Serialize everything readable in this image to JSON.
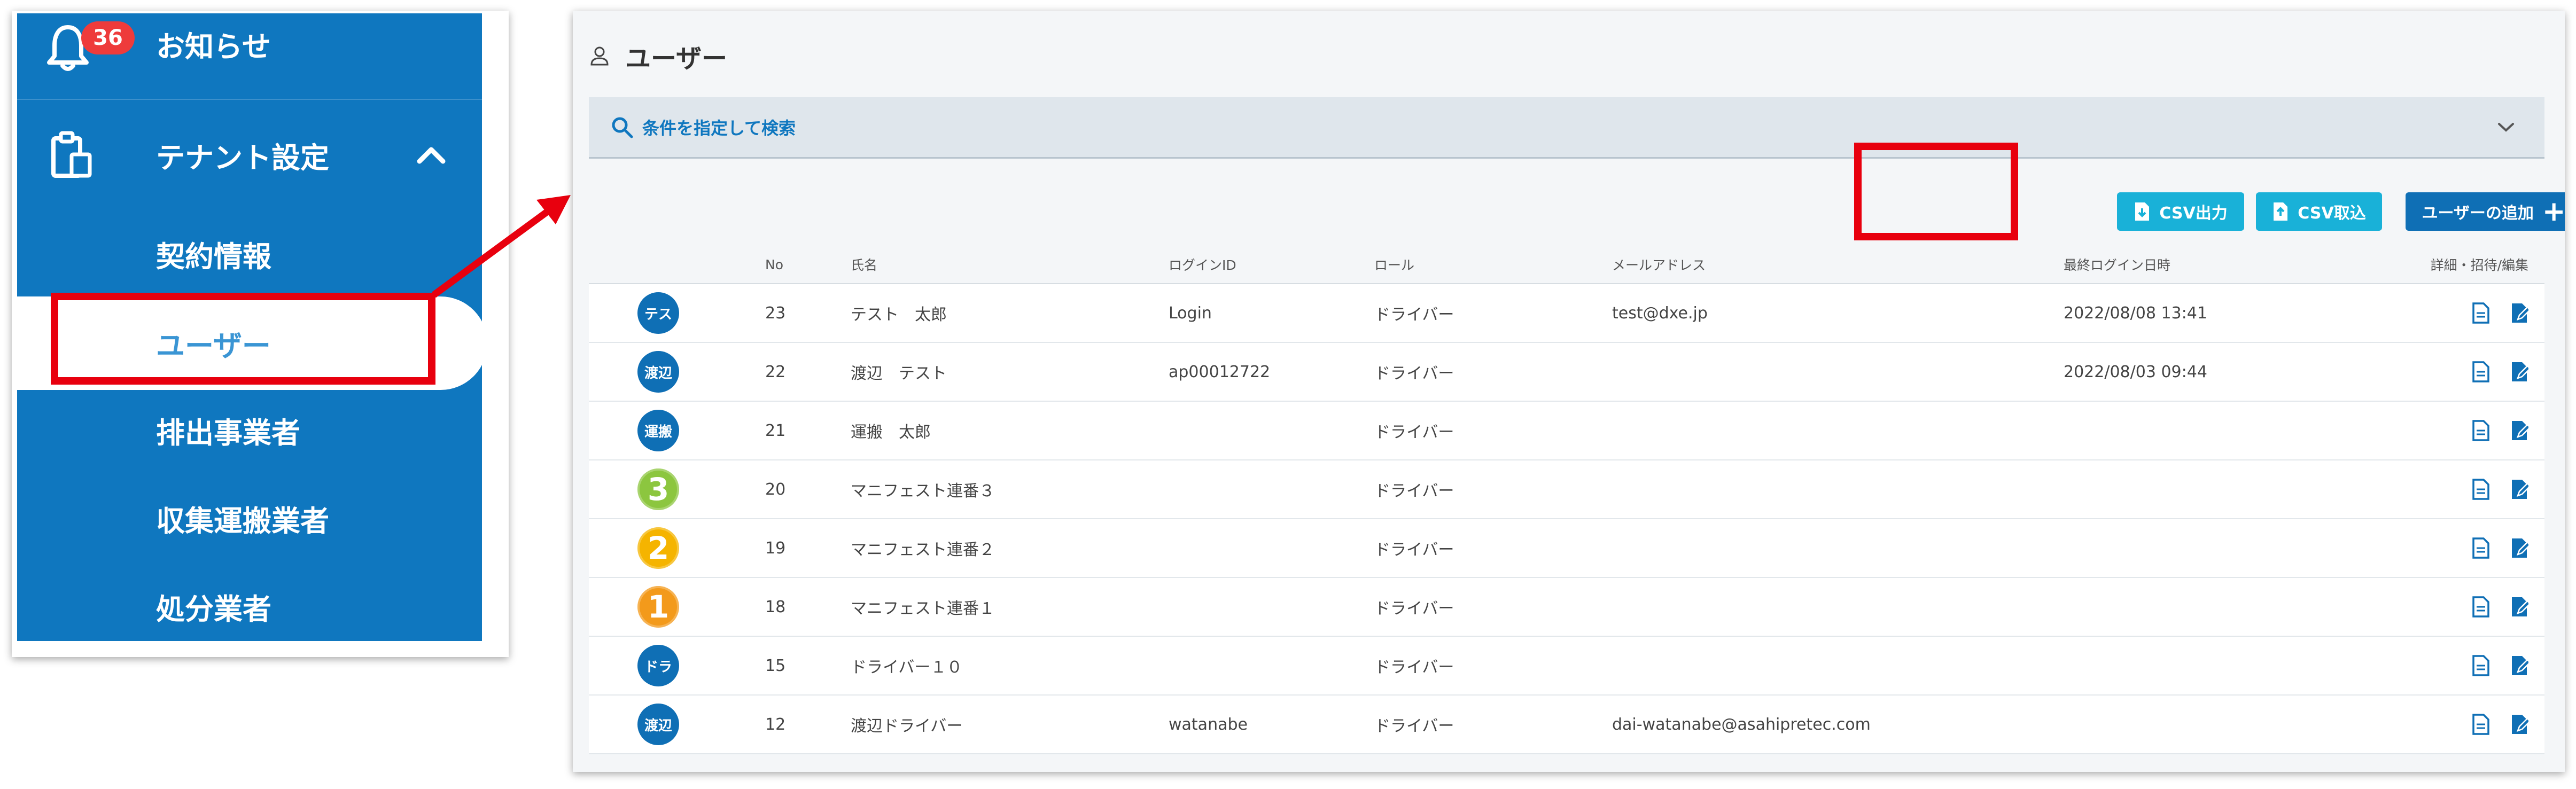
{
  "colors": {
    "primary": "#0f77bf",
    "accent_csv": "#19b1d8",
    "highlight": "#e8000e",
    "badge": "#ee3b3b",
    "avatar_green": "#8cc63f",
    "avatar_yellow": "#f5b400",
    "avatar_orange": "#f39a1b"
  },
  "sidebar": {
    "notification_label": "お知らせ",
    "notification_count": "36",
    "tenant_label": "テナント設定",
    "items": [
      "契約情報",
      "ユーザー",
      "排出事業者",
      "収集運搬業者",
      "処分業者"
    ]
  },
  "page": {
    "title": "ユーザー",
    "search_label": "条件を指定して検索"
  },
  "toolbar": {
    "csv_export": "CSV出力",
    "csv_import": "CSV取込",
    "add_user": "ユーザーの追加"
  },
  "table": {
    "headers": {
      "no": "No",
      "name": "氏名",
      "login": "ログインID",
      "role": "ロール",
      "mail": "メールアドレス",
      "last_login": "最終ログイン日時",
      "actions": "詳細・招待/編集"
    },
    "rows": [
      {
        "avatar": "テス",
        "avatar_type": "text",
        "no": "23",
        "name": "テスト　太郎",
        "login": "Login",
        "role": "ドライバー",
        "mail": "test@dxe.jp",
        "last": "2022/08/08 13:41"
      },
      {
        "avatar": "渡辺",
        "avatar_type": "text",
        "no": "22",
        "name": "渡辺　テスト",
        "login": "ap00012722",
        "role": "ドライバー",
        "mail": "",
        "last": "2022/08/03 09:44"
      },
      {
        "avatar": "運搬",
        "avatar_type": "text",
        "no": "21",
        "name": "運搬　太郎",
        "login": "",
        "role": "ドライバー",
        "mail": "",
        "last": ""
      },
      {
        "avatar": "3",
        "avatar_type": "green",
        "no": "20",
        "name": "マニフェスト連番３",
        "login": "",
        "role": "ドライバー",
        "mail": "",
        "last": ""
      },
      {
        "avatar": "2",
        "avatar_type": "yellow",
        "no": "19",
        "name": "マニフェスト連番２",
        "login": "",
        "role": "ドライバー",
        "mail": "",
        "last": ""
      },
      {
        "avatar": "1",
        "avatar_type": "orange",
        "no": "18",
        "name": "マニフェスト連番１",
        "login": "",
        "role": "ドライバー",
        "mail": "",
        "last": ""
      },
      {
        "avatar": "ドラ",
        "avatar_type": "text",
        "no": "15",
        "name": "ドライバー１０",
        "login": "",
        "role": "ドライバー",
        "mail": "",
        "last": ""
      },
      {
        "avatar": "渡辺",
        "avatar_type": "text",
        "no": "12",
        "name": "渡辺ドライバー",
        "login": "watanabe",
        "role": "ドライバー",
        "mail": "dai-watanabe@asahipretec.com",
        "last": ""
      }
    ]
  }
}
